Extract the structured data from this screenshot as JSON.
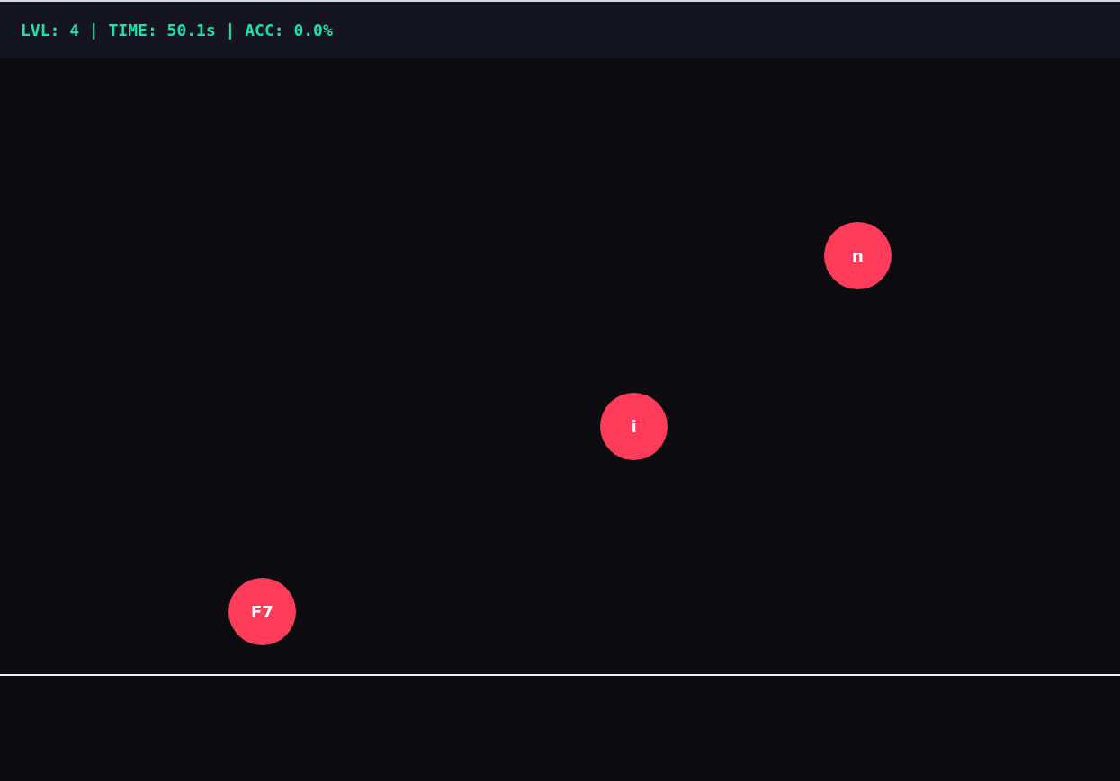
{
  "hud": {
    "stats": "LVL: 4 | TIME: 50.1s | ACC: 0.0%"
  },
  "targets": [
    {
      "label": "n"
    },
    {
      "label": "i"
    },
    {
      "label": "F7"
    }
  ]
}
